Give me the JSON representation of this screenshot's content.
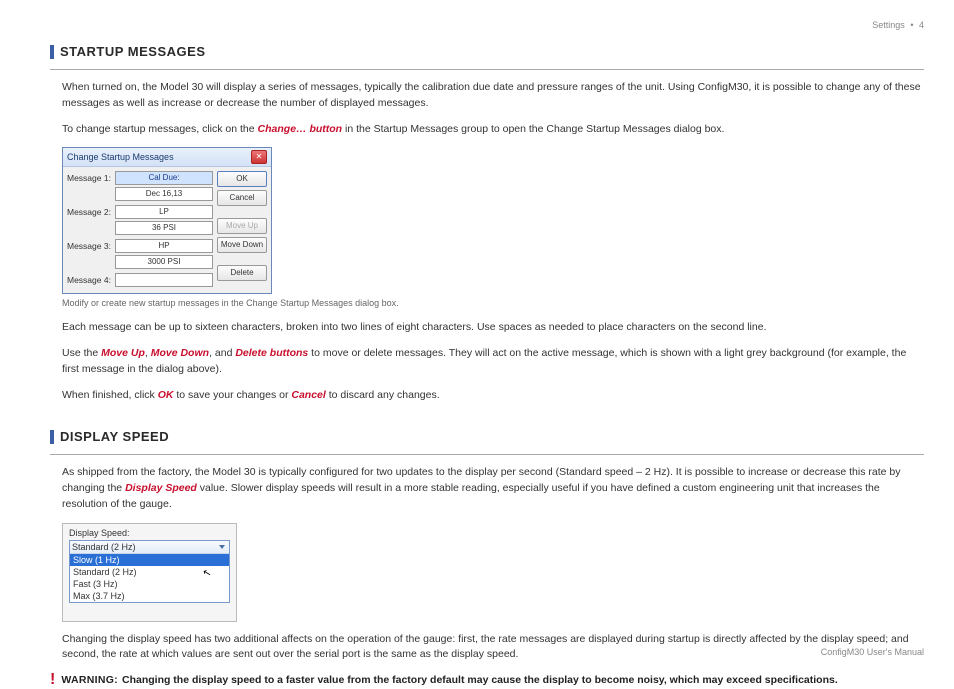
{
  "header": {
    "section": "Settings",
    "page": "4"
  },
  "footer": {
    "text": "ConfigM30 User's Manual"
  },
  "startup": {
    "heading": "STARTUP MESSAGES",
    "p1": "When turned on, the Model 30 will display a series of messages, typically the calibration due date and pressure ranges of the unit. Using ConfigM30, it is possible to change any of these messages as well as increase or decrease the number of displayed messages.",
    "p2a": "To change startup messages, click on the ",
    "p2b": "Change… button",
    "p2c": " in the Startup Messages group to open the Change Startup Messages dialog box.",
    "caption": "Modify or create new startup messages in the Change Startup Messages dialog box.",
    "p3": "Each message can be up to sixteen characters, broken into two lines of eight characters. Use spaces as needed to place characters on the second line.",
    "p4a": "Use the ",
    "p4b": "Move Up",
    "p4c": ", ",
    "p4d": "Move Down",
    "p4e": ", and ",
    "p4f": "Delete buttons",
    "p4g": " to move or delete messages. They will act on the active message, which is shown with a light grey background (for example, the first message in the dialog above).",
    "p5a": "When finished, click ",
    "p5b": "OK",
    "p5c": " to save your changes or ",
    "p5d": "Cancel",
    "p5e": " to discard any changes."
  },
  "dialog": {
    "title": "Change Startup Messages",
    "rows": {
      "r1_label": "Message 1:",
      "r1_v1": "Cal Due:",
      "r1_v2": "Dec 16,13",
      "r2_label": "Message 2:",
      "r2_v1": "LP",
      "r2_v2": "36 PSI",
      "r3_label": "Message 3:",
      "r3_v1": "HP",
      "r3_v2": "3000 PSI",
      "r4_label": "Message 4:"
    },
    "buttons": {
      "ok": "OK",
      "cancel": "Cancel",
      "moveup": "Move Up",
      "movedown": "Move Down",
      "delete": "Delete"
    }
  },
  "speed": {
    "heading": "DISPLAY SPEED",
    "p1a": "As shipped from the factory, the Model 30 is typically configured for two updates to the display per second (Standard speed – 2 Hz). It is possible to increase or decrease this rate by changing the ",
    "p1b": "Display Speed",
    "p1c": " value. Slower display speeds will result in a more stable reading, especially useful if you have defined a custom engineering unit that increases the resolution of the gauge.",
    "panel_label": "Display Speed:",
    "selected": "Standard (2 Hz)",
    "options": {
      "o1": "Slow (1 Hz)",
      "o2": "Standard (2 Hz)",
      "o3": "Fast (3 Hz)",
      "o4": "Max (3.7 Hz)"
    },
    "p2": "Changing the display speed has two additional affects on the operation of the gauge: first, the rate messages are displayed during startup is directly affected by the display speed; and second, the rate at which values are sent out over the serial port is the same as the display speed.",
    "warn_label": "WARNING:",
    "warn_text": "Changing the display speed to a faster value from the factory default may cause the display to become noisy, which may exceed specifications."
  }
}
